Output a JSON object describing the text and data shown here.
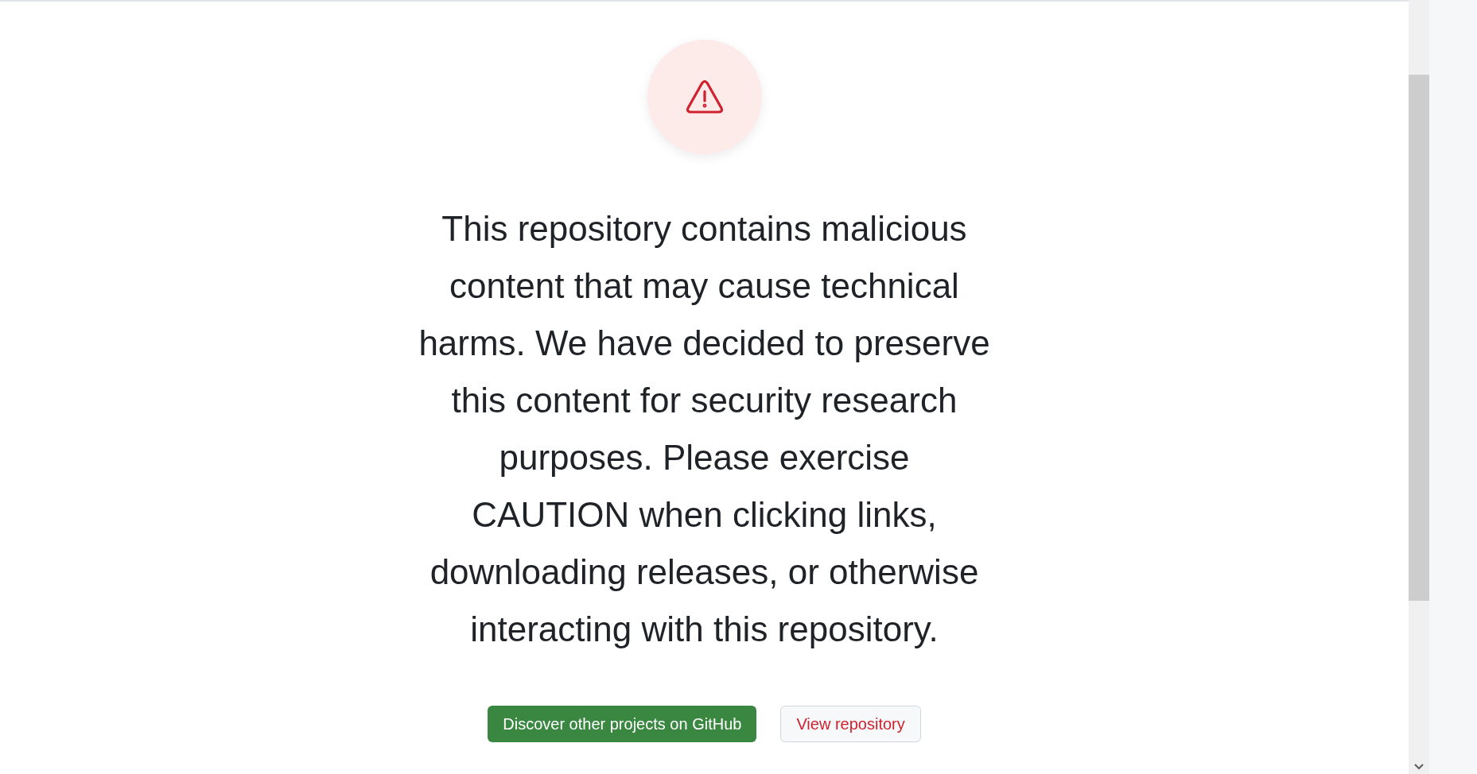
{
  "message": "This repository contains malicious content that may cause technical harms. We have decided to preserve this content for security research purposes. Please exercise CAUTION when clicking links, downloading releases, or otherwise interacting with this repository.",
  "buttons": [
    {
      "label": "Discover other projects on GitHub",
      "kind": "primary"
    },
    {
      "label": "View repository",
      "kind": "secondary"
    }
  ]
}
